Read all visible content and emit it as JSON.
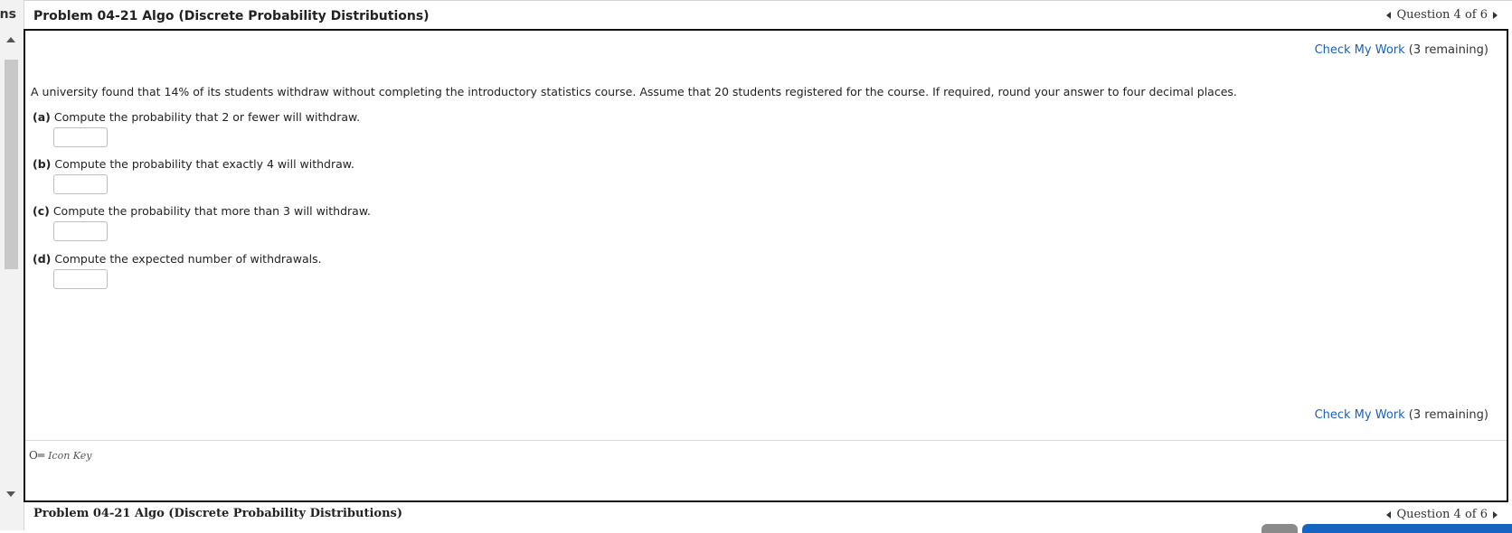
{
  "sidebar": {
    "partial_label": "ons"
  },
  "header": {
    "title": "Problem 04-21 Algo (Discrete Probability Distributions)",
    "question_nav": "Question 4 of 6"
  },
  "check_my_work": {
    "link": "Check My Work",
    "remaining": "(3 remaining)"
  },
  "problem": {
    "stem": "A university found that 14% of its students withdraw without completing the introductory statistics course. Assume that 20 students registered for the course. If required, round your answer to four decimal places.",
    "parts": [
      {
        "label": "(a)",
        "text": "Compute the probability that 2 or fewer will withdraw.",
        "value": ""
      },
      {
        "label": "(b)",
        "text": "Compute the probability that exactly 4 will withdraw.",
        "value": ""
      },
      {
        "label": "(c)",
        "text": "Compute the probability that more than 3 will withdraw.",
        "value": ""
      },
      {
        "label": "(d)",
        "text": "Compute the expected number of withdrawals.",
        "value": ""
      }
    ]
  },
  "icon_key": {
    "label": "Icon Key",
    "icon": "key-icon"
  },
  "footer": {
    "title": "Problem 04-21 Algo (Discrete Probability Distributions)",
    "question_nav": "Question 4 of 6"
  },
  "colors": {
    "link": "#1a62b3",
    "frame_border": "#111111",
    "primary_button": "#1565c0"
  }
}
